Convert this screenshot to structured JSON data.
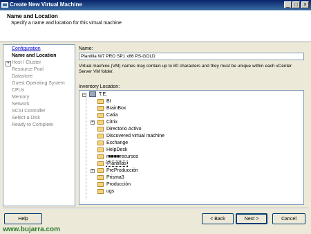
{
  "window": {
    "title": "Create New Virtual Machine",
    "controls": {
      "minimize": "_",
      "maximize": "□",
      "close": "×"
    }
  },
  "header": {
    "title": "Name and Location",
    "subtitle": "Specify a name and location for this virtual machine"
  },
  "steps": [
    {
      "label": "Configuration",
      "state": "link"
    },
    {
      "label": "Name and Location",
      "state": "active"
    },
    {
      "label": "Host / Cluster",
      "state": "disabled",
      "expander": "+"
    },
    {
      "label": "Resource Pool",
      "state": "disabled"
    },
    {
      "label": "Datastore",
      "state": "disabled"
    },
    {
      "label": "Guest Operating System",
      "state": "disabled"
    },
    {
      "label": "CPUs",
      "state": "disabled"
    },
    {
      "label": "Memory",
      "state": "disabled"
    },
    {
      "label": "Network",
      "state": "disabled"
    },
    {
      "label": "SCSI Controller",
      "state": "disabled"
    },
    {
      "label": "Select a Disk",
      "state": "disabled"
    },
    {
      "label": "Ready to Complete",
      "state": "disabled"
    }
  ],
  "form": {
    "name_label": "Name:",
    "name_value": "Plantilla W7 PRO SP1 x86 PS-GOLD",
    "help_text": "Virtual machine (VM) names may contain up to 80 characters and they must be unique within each vCenter Server VM folder.",
    "inventory_label": "Inventory Location:"
  },
  "tree": {
    "root": {
      "label": "T.E.",
      "expander": "−"
    },
    "children": [
      {
        "label": "BI"
      },
      {
        "label": "BrainBox"
      },
      {
        "label": "Catia"
      },
      {
        "label": "Citrix",
        "expander": "+"
      },
      {
        "label": "Directorio Activo"
      },
      {
        "label": "Discovered virtual machine"
      },
      {
        "label": "Exchange"
      },
      {
        "label": "HelpDesk"
      },
      {
        "label": "r■■■■recursos"
      },
      {
        "label": "Plantillas",
        "selected": true
      },
      {
        "label": "PreProducción",
        "expander": "+"
      },
      {
        "label": "Prisma3"
      },
      {
        "label": "Producción"
      },
      {
        "label": "ugs"
      }
    ]
  },
  "buttons": {
    "help": "Help",
    "back": "< Back",
    "next": "Next >",
    "cancel": "Cancel"
  },
  "watermark": "www.bujarra.com"
}
